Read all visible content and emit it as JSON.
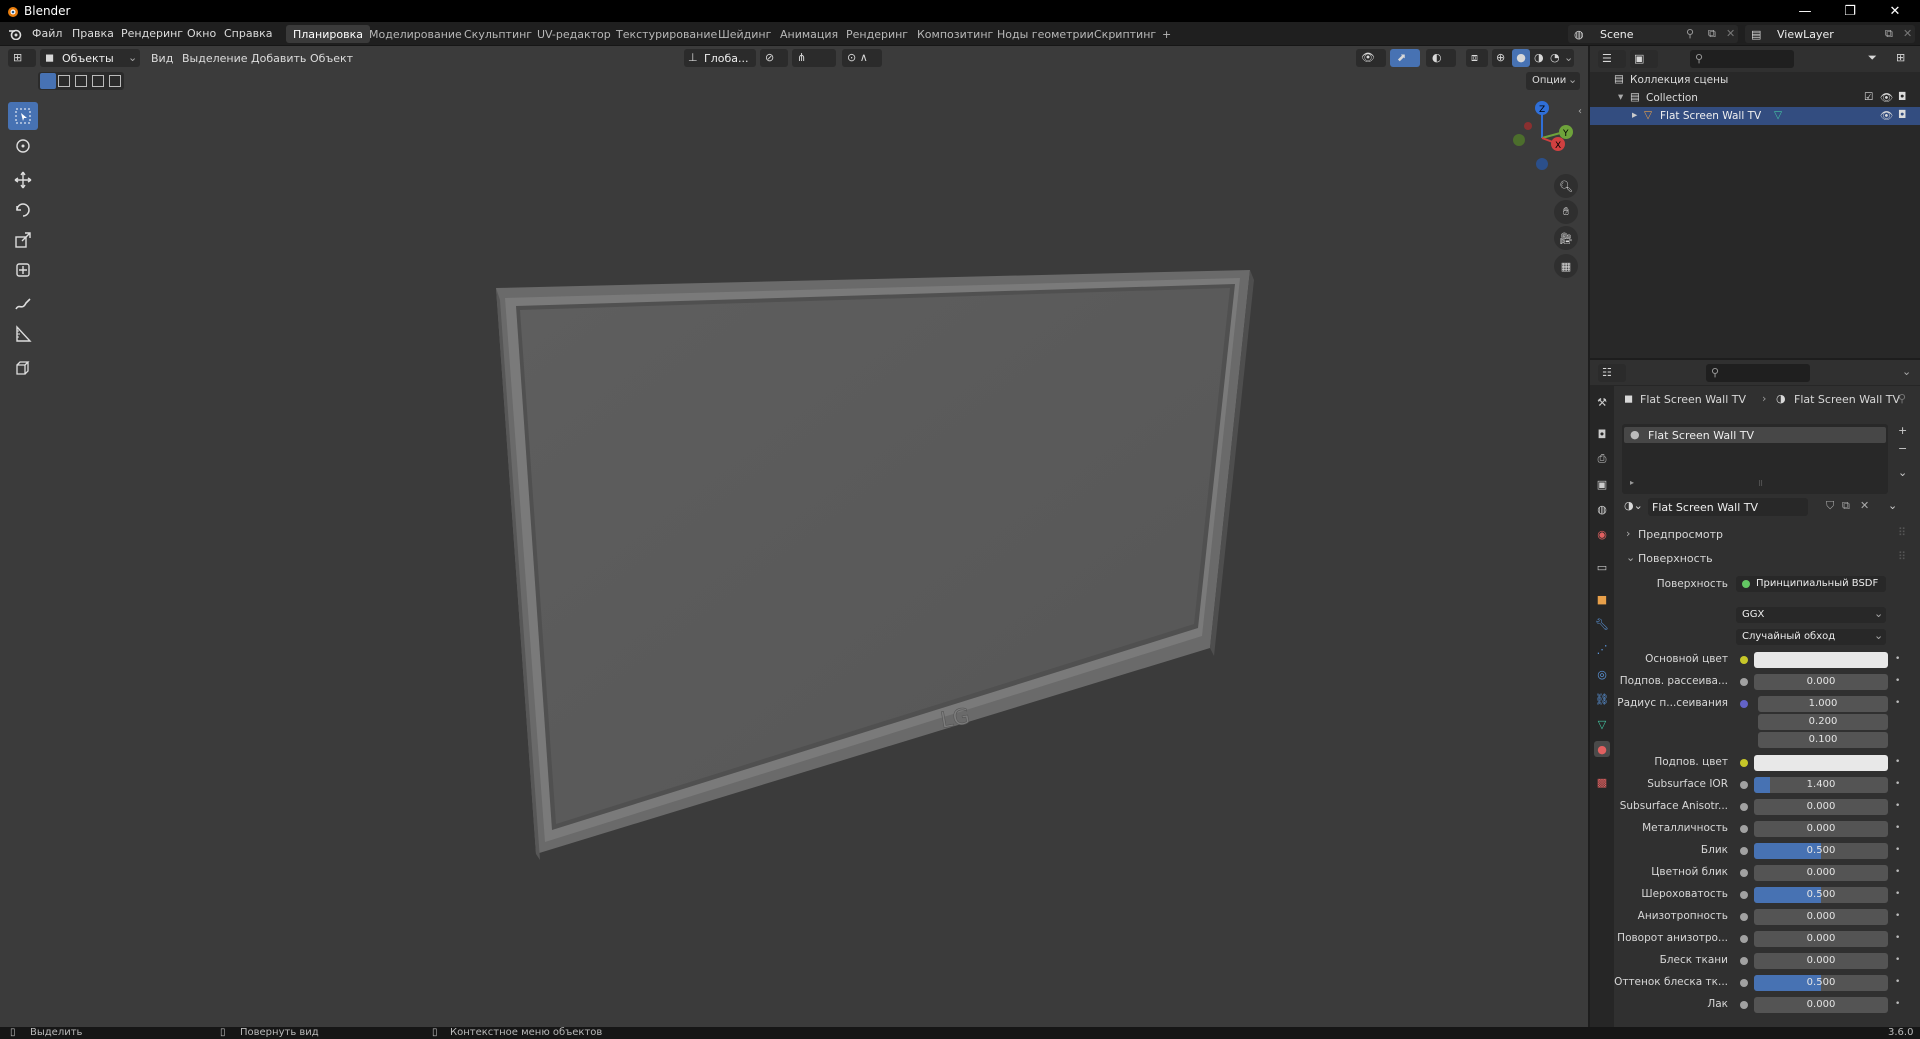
{
  "titlebar": {
    "title": "Blender",
    "min_icon": "minimize-icon",
    "max_icon": "restore-icon",
    "close_icon": "close-icon"
  },
  "menu": {
    "file": "Файл",
    "edit": "Правка",
    "render": "Рендеринг",
    "window": "Окно",
    "help": "Справка"
  },
  "workspaces": [
    "Планировка",
    "Моделирование",
    "Скульптинг",
    "UV-редактор",
    "Текстурирование",
    "Шейдинг",
    "Анимация",
    "Рендеринг",
    "Композитинг",
    "Ноды геометрии",
    "Скриптинг",
    "+"
  ],
  "active_workspace": 0,
  "scene": {
    "name": "Scene",
    "viewlayer": "ViewLayer"
  },
  "viewport_header": {
    "mode": "Объекты",
    "view": "Вид",
    "select": "Выделение",
    "add": "Добавить",
    "object": "Объект",
    "orientation": "Глоба...",
    "options": "Опции"
  },
  "gizmo": {
    "z": "Z",
    "y": "Y",
    "x": "X"
  },
  "scene_object": {
    "logo_text": "LG"
  },
  "outliner": {
    "root": "Коллекция сцены",
    "collection": "Collection",
    "object": "Flat Screen Wall TV"
  },
  "properties": {
    "breadcrumb_object": "Flat Screen Wall TV",
    "breadcrumb_material": "Flat Screen Wall TV",
    "slot_name": "Flat Screen Wall TV",
    "material_name": "Flat Screen Wall TV",
    "panel_preview": "Предпросмотр",
    "panel_surface": "Поверхность",
    "surface_label": "Поверхность",
    "surface_value": "Принципиальный BSDF",
    "distribution": "GGX",
    "subsurface_method": "Случайный обход",
    "rows": [
      {
        "label": "Основной цвет",
        "type": "color",
        "value": ""
      },
      {
        "label": "Подпов. рассеива...",
        "type": "num",
        "value": "0.000",
        "fill": 0
      },
      {
        "label": "Радиус п...сеивания",
        "type": "vec",
        "values": [
          "1.000",
          "0.200",
          "0.100"
        ]
      },
      {
        "label": "Подпов. цвет",
        "type": "color",
        "value": ""
      },
      {
        "label": "Subsurface IOR",
        "type": "num",
        "value": "1.400",
        "fill": 0.12
      },
      {
        "label": "Subsurface Anisotr...",
        "type": "num",
        "value": "0.000",
        "fill": 0
      },
      {
        "label": "Металличность",
        "type": "num",
        "value": "0.000",
        "fill": 0
      },
      {
        "label": "Блик",
        "type": "num",
        "value": "0.500",
        "fill": 0.5
      },
      {
        "label": "Цветной блик",
        "type": "num",
        "value": "0.000",
        "fill": 0
      },
      {
        "label": "Шероховатость",
        "type": "num",
        "value": "0.500",
        "fill": 0.5
      },
      {
        "label": "Анизотропность",
        "type": "num",
        "value": "0.000",
        "fill": 0
      },
      {
        "label": "Поворот анизотро...",
        "type": "num",
        "value": "0.000",
        "fill": 0
      },
      {
        "label": "Блеск ткани",
        "type": "num",
        "value": "0.000",
        "fill": 0
      },
      {
        "label": "Оттенок блеска тк...",
        "type": "num",
        "value": "0.500",
        "fill": 0.5
      },
      {
        "label": "Лак",
        "type": "num",
        "value": "0.000",
        "fill": 0
      }
    ]
  },
  "statusbar": {
    "select": "Выделить",
    "rotate": "Повернуть вид",
    "context": "Контекстное меню объектов",
    "version": "3.6.0"
  },
  "colors": {
    "accent": "#4772b3",
    "selected_row": "#334d80",
    "viewport_bg": "#3b3b3b"
  }
}
